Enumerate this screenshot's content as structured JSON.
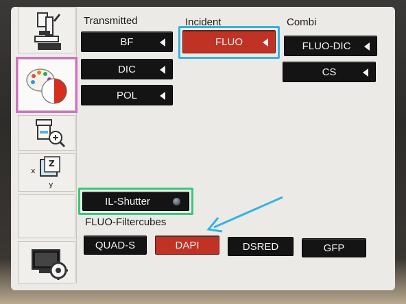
{
  "groups": {
    "transmitted": "Transmitted",
    "incident": "Incident",
    "combi": "Combi",
    "filtercubes": "FLUO-Filtercubes"
  },
  "buttons": {
    "bf": "BF",
    "dic": "DIC",
    "pol": "POL",
    "fluo": "FLUO",
    "fluo_dic": "FLUO-DIC",
    "cs": "CS",
    "il_shutter": "IL-Shutter"
  },
  "filtercubes": [
    "QUAD-S",
    "DAPI",
    "DSRED",
    "GFP"
  ],
  "sidebar": {
    "xyz_x": "x",
    "xyz_y": "y",
    "xyz_z": "Z"
  },
  "colors": {
    "selected_button": "#c03224",
    "button": "#141414",
    "highlight_blue": "#35b2e3",
    "highlight_green": "#37c97a",
    "highlight_pink": "#d76fc4",
    "arrow": "#35b2e3"
  },
  "icons": {
    "microscope": "microscope-icon",
    "contrast": "contrast-palette-icon",
    "magnifier": "objective-magnifier-icon",
    "xyz": "xyz-stage-icon",
    "settings": "monitor-settings-icon"
  }
}
